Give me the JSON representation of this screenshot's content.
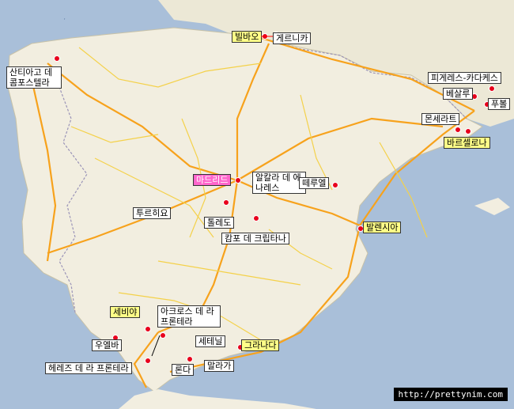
{
  "map": {
    "colors": {
      "sea": "#a9bfd9",
      "land": "#f2eee0",
      "france": "#ece8d6",
      "highway": "#f7a21c",
      "road": "#f4d14a",
      "label_bg": "#ffffff",
      "highlight_bg": "#ffff88",
      "capital_bg": "#ff66cc",
      "marker": "#e8001c"
    },
    "labels": [
      {
        "id": "bilbao",
        "text": "빌바오",
        "style": "highlight"
      },
      {
        "id": "guernica",
        "text": "게르니카",
        "style": "plain"
      },
      {
        "id": "santiago",
        "text": "산티아고 데 콤포스텔라",
        "style": "plain"
      },
      {
        "id": "figueres",
        "text": "피게레스-카다케스",
        "style": "plain"
      },
      {
        "id": "besalu",
        "text": "베살루",
        "style": "plain"
      },
      {
        "id": "pubol",
        "text": "푸볼",
        "style": "plain"
      },
      {
        "id": "montserrat",
        "text": "몬세라트",
        "style": "plain"
      },
      {
        "id": "barcelona",
        "text": "바르셀로나",
        "style": "highlight"
      },
      {
        "id": "madrid",
        "text": "마드리드",
        "style": "capital"
      },
      {
        "id": "alcala",
        "text": "알칼라 데 에나레스",
        "style": "plain"
      },
      {
        "id": "teruel",
        "text": "떼루엘",
        "style": "plain"
      },
      {
        "id": "trujillo",
        "text": "투르히요",
        "style": "plain"
      },
      {
        "id": "toledo",
        "text": "톨레도",
        "style": "plain"
      },
      {
        "id": "campo",
        "text": "캄포 데 크립타나",
        "style": "plain"
      },
      {
        "id": "valencia",
        "text": "발렌시아",
        "style": "highlight"
      },
      {
        "id": "sevilla",
        "text": "세비야",
        "style": "highlight"
      },
      {
        "id": "arcos",
        "text": "아크로스 데 라 프론테라",
        "style": "plain"
      },
      {
        "id": "huelva",
        "text": "우엘바",
        "style": "plain"
      },
      {
        "id": "setenil",
        "text": "세테닐",
        "style": "plain"
      },
      {
        "id": "granada",
        "text": "그라나다",
        "style": "highlight"
      },
      {
        "id": "jerez",
        "text": "헤레즈 데 라 프론테라",
        "style": "plain"
      },
      {
        "id": "ronda",
        "text": "론다",
        "style": "plain"
      },
      {
        "id": "malaga",
        "text": "말라가",
        "style": "plain"
      }
    ],
    "credit": "http://prettynim.com"
  }
}
